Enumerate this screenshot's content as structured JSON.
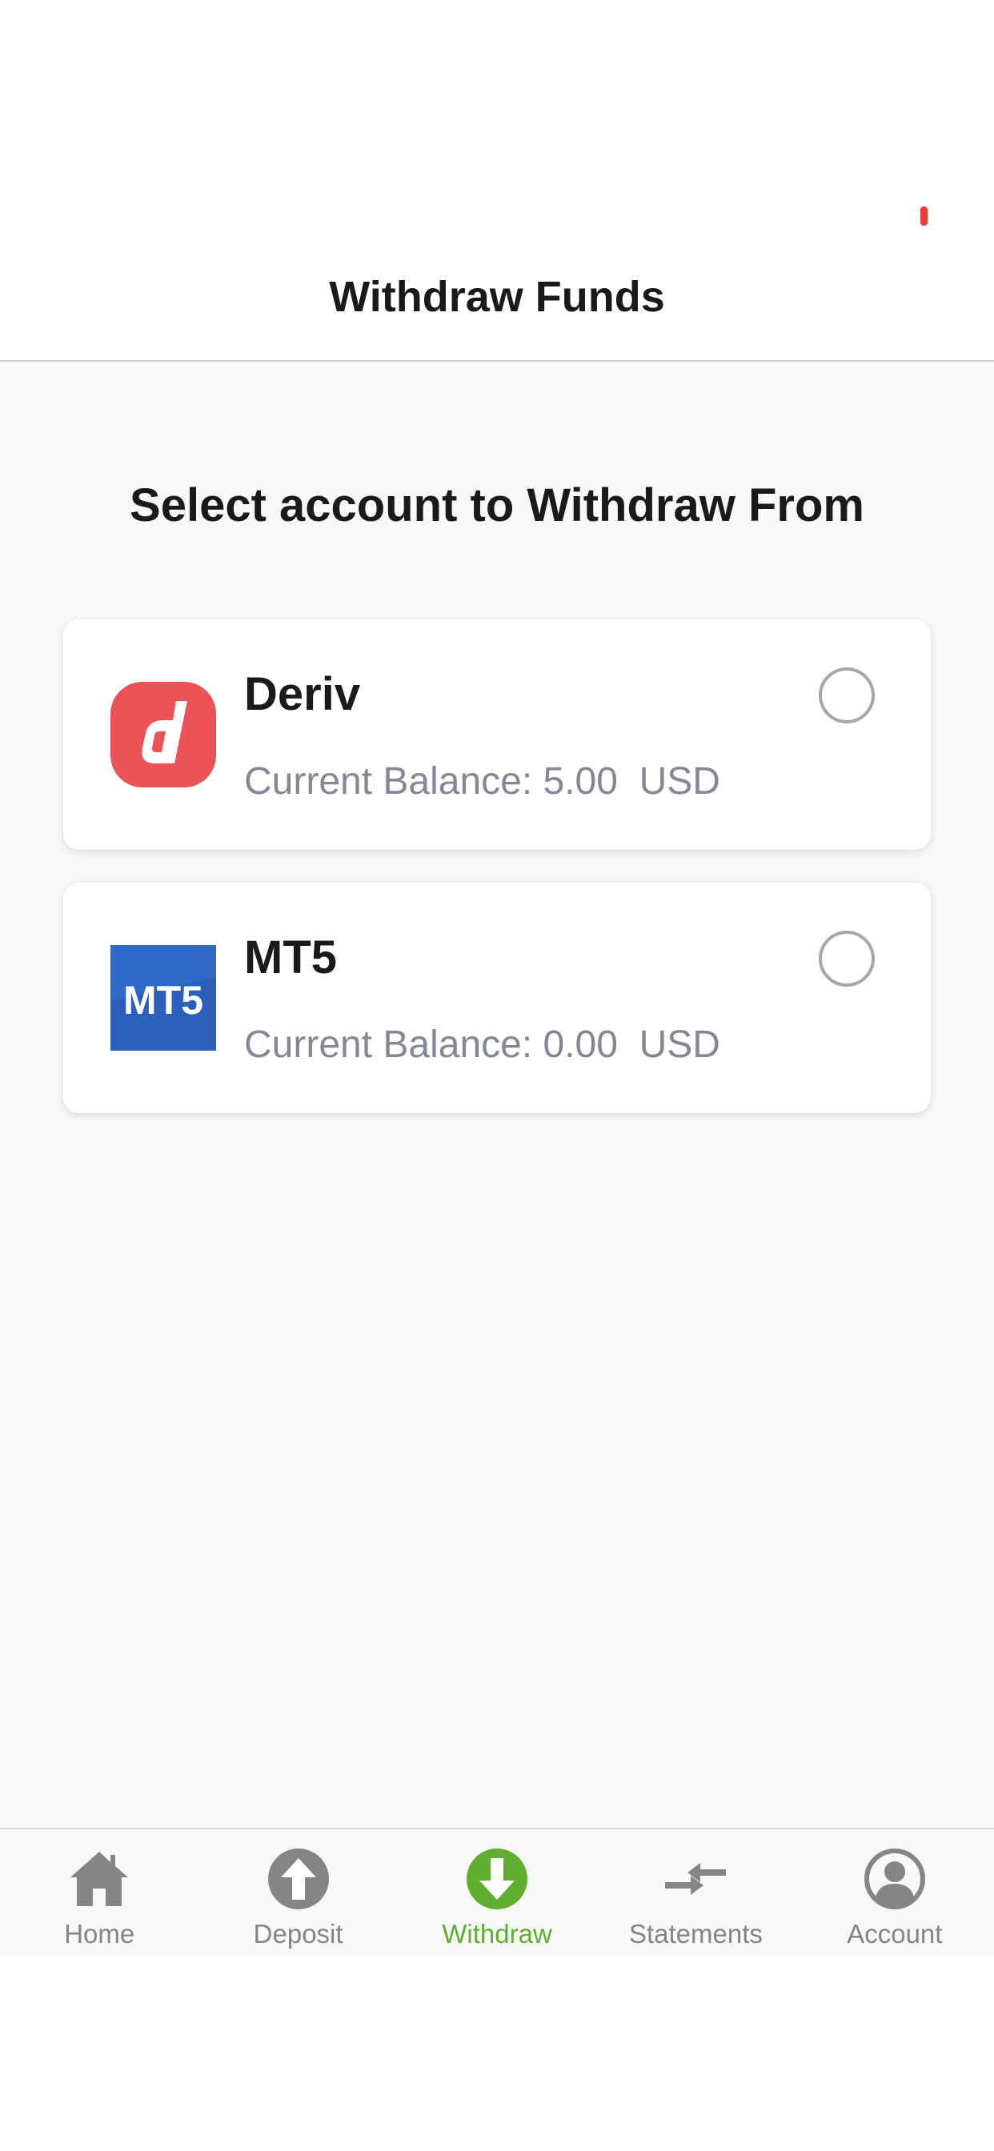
{
  "header": {
    "title": "Withdraw Funds"
  },
  "main": {
    "section_title": "Select account to Withdraw From",
    "accounts": [
      {
        "name": "Deriv",
        "balance_label": "Current Balance:",
        "balance_value": "5.00",
        "currency": "USD",
        "balance_text": "Current Balance: 5.00  USD",
        "logo_icon": "deriv-logo",
        "logo_color": "#ec5256"
      },
      {
        "name": "MT5",
        "balance_label": "Current Balance:",
        "balance_value": "0.00",
        "currency": "USD",
        "balance_text": "Current Balance: 0.00  USD",
        "logo_icon": "mt5-logo",
        "logo_text": "MT5",
        "logo_color": "#2a5fbb"
      }
    ]
  },
  "tabbar": {
    "items": [
      {
        "label": "Home",
        "icon": "home-icon"
      },
      {
        "label": "Deposit",
        "icon": "arrow-up-circle-icon"
      },
      {
        "label": "Withdraw",
        "icon": "arrow-down-circle-icon",
        "active": true
      },
      {
        "label": "Statements",
        "icon": "transfer-arrows-icon"
      },
      {
        "label": "Account",
        "icon": "user-circle-icon"
      }
    ]
  },
  "colors": {
    "accent": "#5fae2e",
    "inactive": "#858585",
    "deriv_red": "#ec5256",
    "mt5_blue": "#2a5fbb",
    "balance_text": "#838796"
  }
}
